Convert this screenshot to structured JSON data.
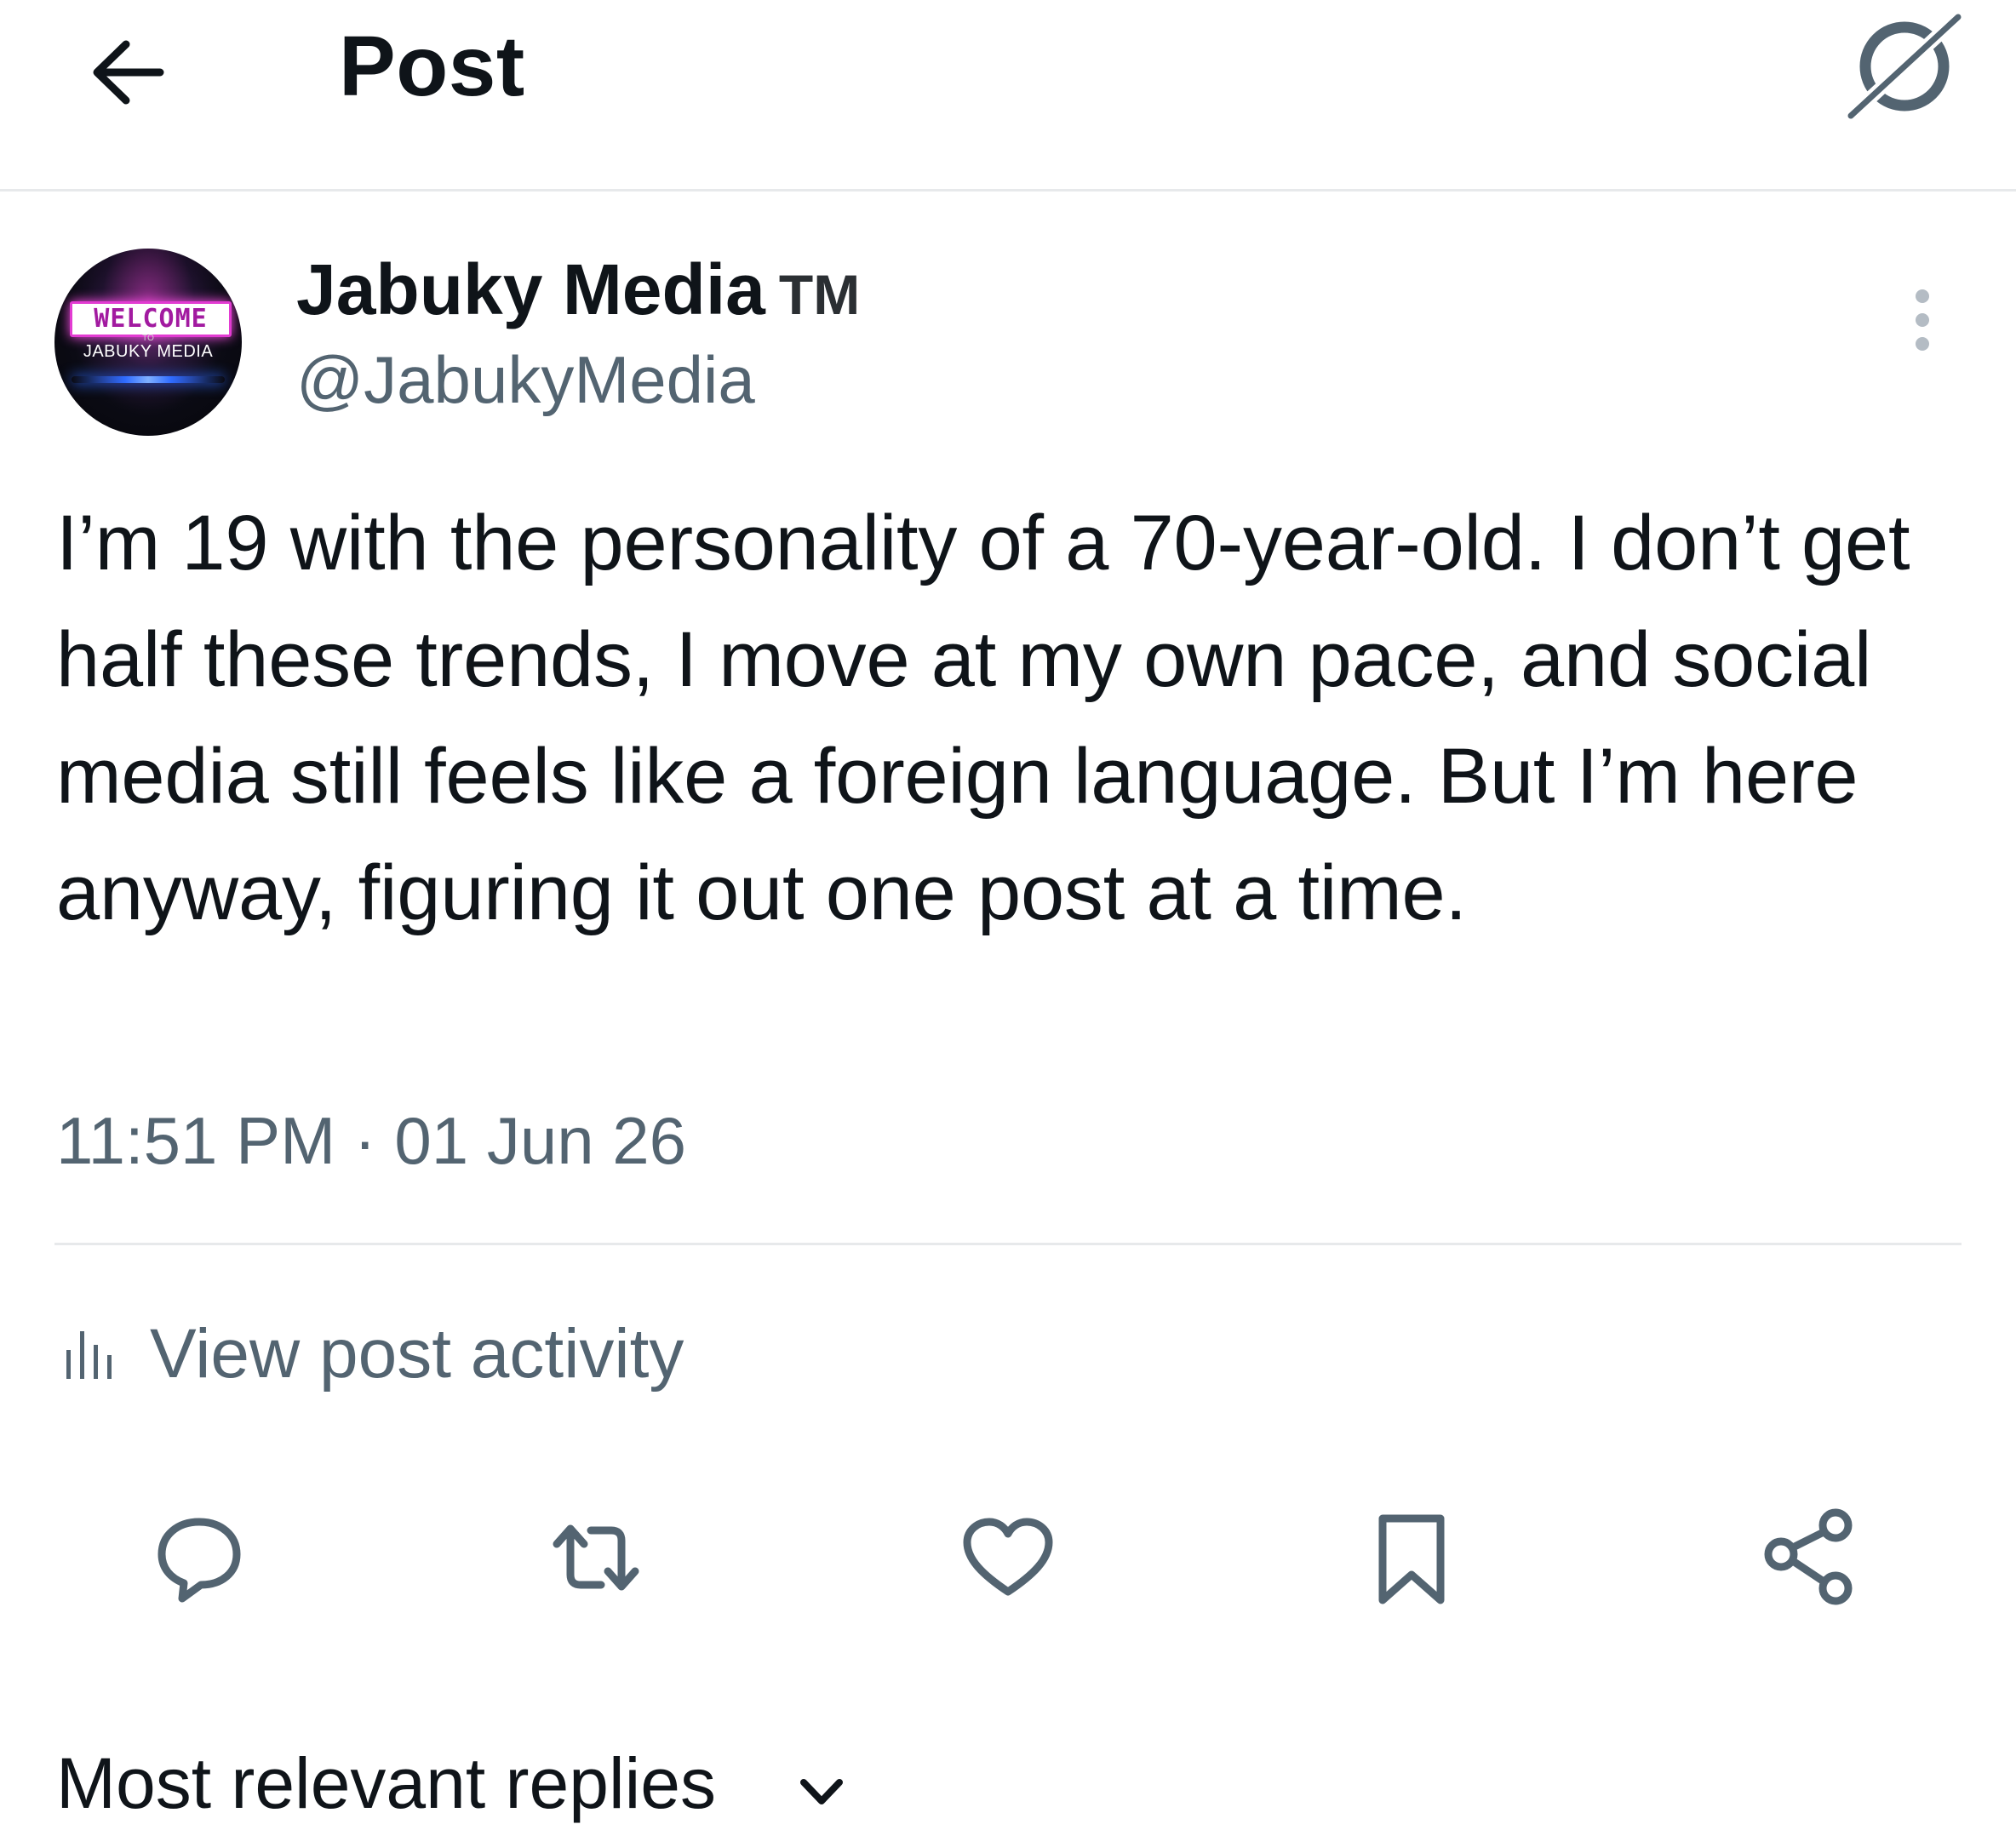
{
  "header": {
    "title": "Post",
    "back_icon": "arrow-left-icon",
    "grok_icon": "grok-slash-circle-icon"
  },
  "author": {
    "display_name": "Jabuky Media",
    "badge": "TM",
    "handle": "@JabukyMedia",
    "avatar": {
      "welcome_text": "WELCOME",
      "to_text": "TO",
      "brand_text": "JABUKY MEDIA"
    },
    "more_icon": "vertical-ellipsis-icon"
  },
  "post": {
    "text": "I’m 19 with the personality of a 70-year-old. I don’t get half these trends, I move at my own pace, and social media still feels like a foreign language. But I’m here anyway, figuring it out one post at a time.",
    "timestamp": "11:51 PM · 01 Jun 26"
  },
  "activity": {
    "label": "View post activity",
    "icon": "bar-chart-icon"
  },
  "actions": [
    {
      "name": "reply",
      "icon": "speech-bubble-icon"
    },
    {
      "name": "repost",
      "icon": "repost-arrows-icon"
    },
    {
      "name": "like",
      "icon": "heart-icon"
    },
    {
      "name": "bookmark",
      "icon": "bookmark-icon"
    },
    {
      "name": "share",
      "icon": "share-nodes-icon"
    }
  ],
  "replies": {
    "sort_label": "Most relevant replies"
  },
  "colors": {
    "text_primary": "#0f1419",
    "text_secondary": "#536471",
    "divider": "#e7e9eb"
  }
}
